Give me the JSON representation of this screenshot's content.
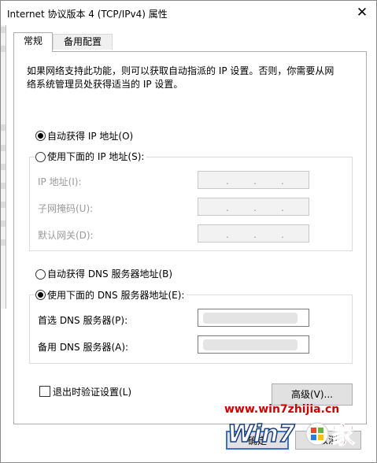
{
  "window": {
    "title": "Internet 协议版本 4 (TCP/IPv4) 属性"
  },
  "tabs": [
    {
      "label": "常规"
    },
    {
      "label": "备用配置"
    }
  ],
  "general": {
    "description": "如果网络支持此功能，则可以获取自动指派的 IP 设置。否则，你需要从网络系统管理员处获得适当的 IP 设置。",
    "ip_mode": {
      "auto_label": "自动获得 IP 地址(O)",
      "manual_label": "使用下面的 IP 地址(S):",
      "selected": "auto"
    },
    "ip_fields": {
      "ip_address_label": "IP 地址(I):",
      "subnet_mask_label": "子网掩码(U):",
      "default_gateway_label": "默认网关(D):",
      "separator": "."
    },
    "dns_mode": {
      "auto_label": "自动获得 DNS 服务器地址(B)",
      "manual_label": "使用下面的 DNS 服务器地址(E):",
      "selected": "manual"
    },
    "dns_fields": {
      "preferred_label": "首选 DNS 服务器(P):",
      "alternate_label": "备用 DNS 服务器(A):"
    },
    "validate_on_exit": {
      "label": "退出时验证设置(L)",
      "checked": false
    },
    "advanced_button": "高级(V)..."
  },
  "footer": {
    "ok_button": "确定",
    "cancel_button": "取消"
  },
  "watermark": {
    "url": "www.win7zhijia.cn",
    "brand": "Win7",
    "suffix": "家"
  }
}
